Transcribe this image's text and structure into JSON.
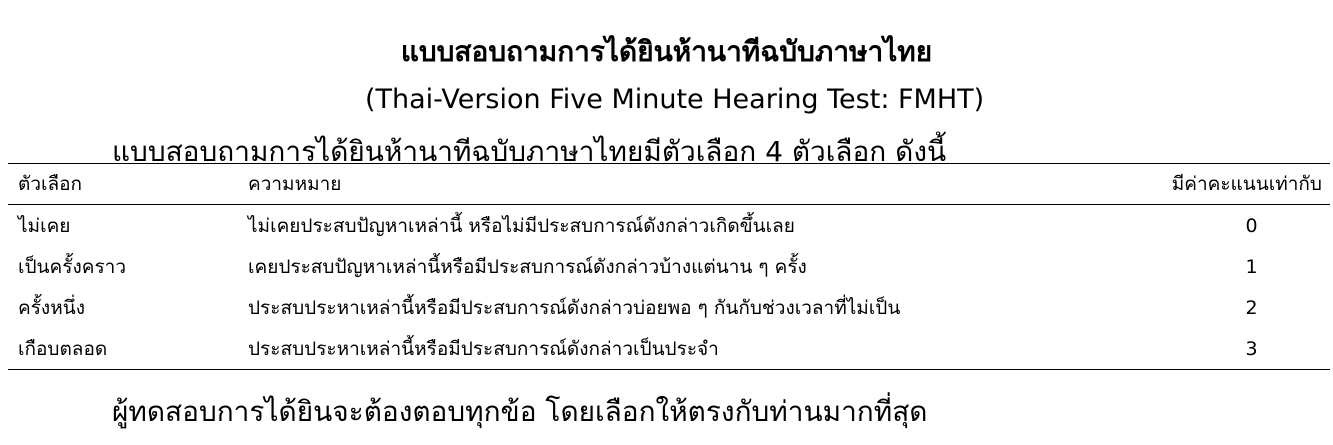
{
  "title": "แบบสอบถามการได้ยินห้านาทีฉบับภาษาไทย",
  "subtitle": "(Thai-Version Five Minute Hearing Test: FMHT)",
  "intro": "แบบสอบถามการได้ยินห้านาทีฉบับภาษาไทยมีตัวเลือก 4 ตัวเลือก ดังนี้",
  "table": {
    "headers": [
      "ตัวเลือก",
      "ความหมาย",
      "มีค่าคะแนนเท่ากับ"
    ],
    "rows": [
      {
        "option": "ไม่เคย",
        "meaning": "ไม่เคยประสบปัญหาเหล่านี้ หรือไม่มีประสบการณ์ดังกล่าวเกิดขึ้นเลย",
        "score": "0"
      },
      {
        "option": "เป็นครั้งคราว",
        "meaning": "เคยประสบปัญหาเหล่านี้หรือมีประสบการณ์ดังกล่าวบ้างแต่นาน ๆ ครั้ง",
        "score": "1"
      },
      {
        "option": "ครั้งหนึ่ง",
        "meaning": "ประสบประหาเหล่านี้หรือมีประสบการณ์ดังกล่าวบ่อยพอ ๆ กันกับช่วงเวลาที่ไม่เป็น",
        "score": "2"
      },
      {
        "option": "เกือบตลอด",
        "meaning": "ประสบประหาเหล่านี้หรือมีประสบการณ์ดังกล่าวเป็นประจำ",
        "score": "3"
      }
    ]
  },
  "footer": "ผู้ทดสอบการได้ยินจะต้องตอบทุกข้อ โดยเลือกให้ตรงกับท่านมากที่สุด"
}
